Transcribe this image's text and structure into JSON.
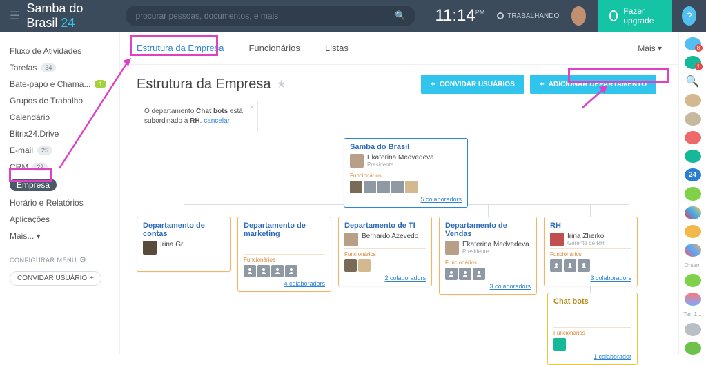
{
  "header": {
    "brand_main": "Samba do Brasil",
    "brand_suffix": "24",
    "search_placeholder": "procurar pessoas, documentos, e mais",
    "time": "11:14",
    "time_suffix": "PM",
    "working": "TRABALHANDO",
    "upgrade": "Fazer upgrade",
    "help": "?"
  },
  "sidebar": {
    "items": [
      {
        "label": "Fluxo de Atividades"
      },
      {
        "label": "Tarefas",
        "badge": "34"
      },
      {
        "label": "Bate-papo e Chama...",
        "badge": "1",
        "green": true
      },
      {
        "label": "Grupos de Trabalho"
      },
      {
        "label": "Calendário"
      },
      {
        "label": "Bitrix24.Drive"
      },
      {
        "label": "E-mail",
        "badge": "25"
      },
      {
        "label": "CRM",
        "badge": "22"
      },
      {
        "label": "Empresa",
        "active": true
      },
      {
        "label": "Horário e Relatórios"
      },
      {
        "label": "Aplicações"
      },
      {
        "label": "Mais... ▾"
      }
    ],
    "configure": "CONFIGURAR MENU",
    "invite": "CONVIDAR USUÁRIO"
  },
  "tabs": {
    "t0": "Estrutura da Empresa",
    "t1": "Funcionários",
    "t2": "Listas",
    "more": "Mais ▾"
  },
  "page": {
    "title": "Estrutura da Empresa",
    "btn_invite": "CONVIDAR USUÁRIOS",
    "btn_add_dept": "ADICIONAR DEPARTAMENTO"
  },
  "notice": {
    "line1": "O departamento ",
    "bold": "Chat bots",
    "line2": " está subordinado à ",
    "bold2": "RH",
    "cancel": "cancelar"
  },
  "org": {
    "func": "Funcionários",
    "root": {
      "title": "Samba do Brasil",
      "person": "Ekaterina Medvedeva",
      "role": "Presidente",
      "colab": "5 colaboradors"
    },
    "d0": {
      "title": "Departamento de contas",
      "person": "Irina Gr"
    },
    "d1": {
      "title": "Departamento de marketing",
      "colab": "4 colaboradors"
    },
    "d2": {
      "title": "Departamento de TI",
      "person": "Bernardo Azevedo",
      "colab": "2 colaboradors"
    },
    "d3": {
      "title": "Departamento de Vendas",
      "person": "Ekaterina Medvedeva",
      "role": "Presidente",
      "colab": "3 colaboradors"
    },
    "d4": {
      "title": "RH",
      "person": "Irina Zherko",
      "role": "Gerente de RH",
      "colab": "3 colaboradors"
    },
    "d5": {
      "title": "Chat bots",
      "colab": "1 colaborador"
    }
  },
  "rail": {
    "b0": "8",
    "b1": "1",
    "ontem": "Ontem",
    "ter": "Ter, 1..."
  }
}
